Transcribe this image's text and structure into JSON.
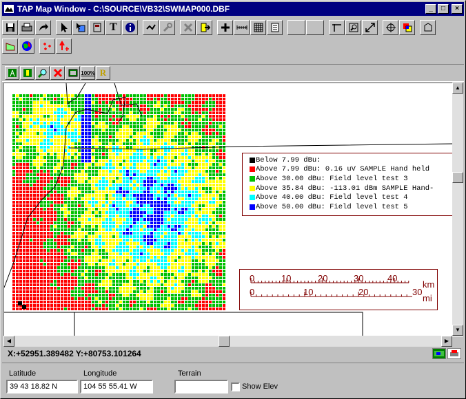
{
  "window": {
    "title": "TAP Map Window - C:\\SOURCE\\VB32\\SWMAP000.DBF"
  },
  "title_buttons": {
    "minimize": "_",
    "maximize": "□",
    "close": "×"
  },
  "legend": [
    {
      "label": "Below   7.99 dBu:",
      "color": "#000000"
    },
    {
      "label": "Above   7.99 dBu: 0.16 uV SAMPLE Hand held",
      "color": "#ff0000"
    },
    {
      "label": "Above  30.00 dBu: Field level test 3",
      "color": "#00c000"
    },
    {
      "label": "Above  35.84 dBu: -113.01 dBm SAMPLE Hand-",
      "color": "#ffff00"
    },
    {
      "label": "Above  40.00 dBu: Field level test 4",
      "color": "#00ffff"
    },
    {
      "label": "Above  50.00 dBu: Field level test 5",
      "color": "#0000ff"
    }
  ],
  "scale": {
    "km_ticks": [
      "0",
      "10",
      "20",
      "30",
      "40"
    ],
    "km_unit": "km",
    "mi_ticks": [
      "0",
      "10",
      "20",
      "30"
    ],
    "mi_unit": "mi"
  },
  "status": {
    "coords": "X:+52951.389482 Y:+80753.101264"
  },
  "fields": {
    "latitude_label": "Latitude",
    "latitude_value": "39 43 18.82 N",
    "longitude_label": "Longitude",
    "longitude_value": "104 55 55.41 W",
    "terrain_label": "Terrain",
    "terrain_value": "",
    "show_elev_label": "Show Elev"
  },
  "toolbar2": {
    "zoom100_label": "100%",
    "r_label": "R"
  },
  "colors": {
    "red": "#ff0000",
    "green": "#00c000",
    "yellow": "#ffff00",
    "cyan": "#00ffff",
    "blue": "#0000ff"
  }
}
